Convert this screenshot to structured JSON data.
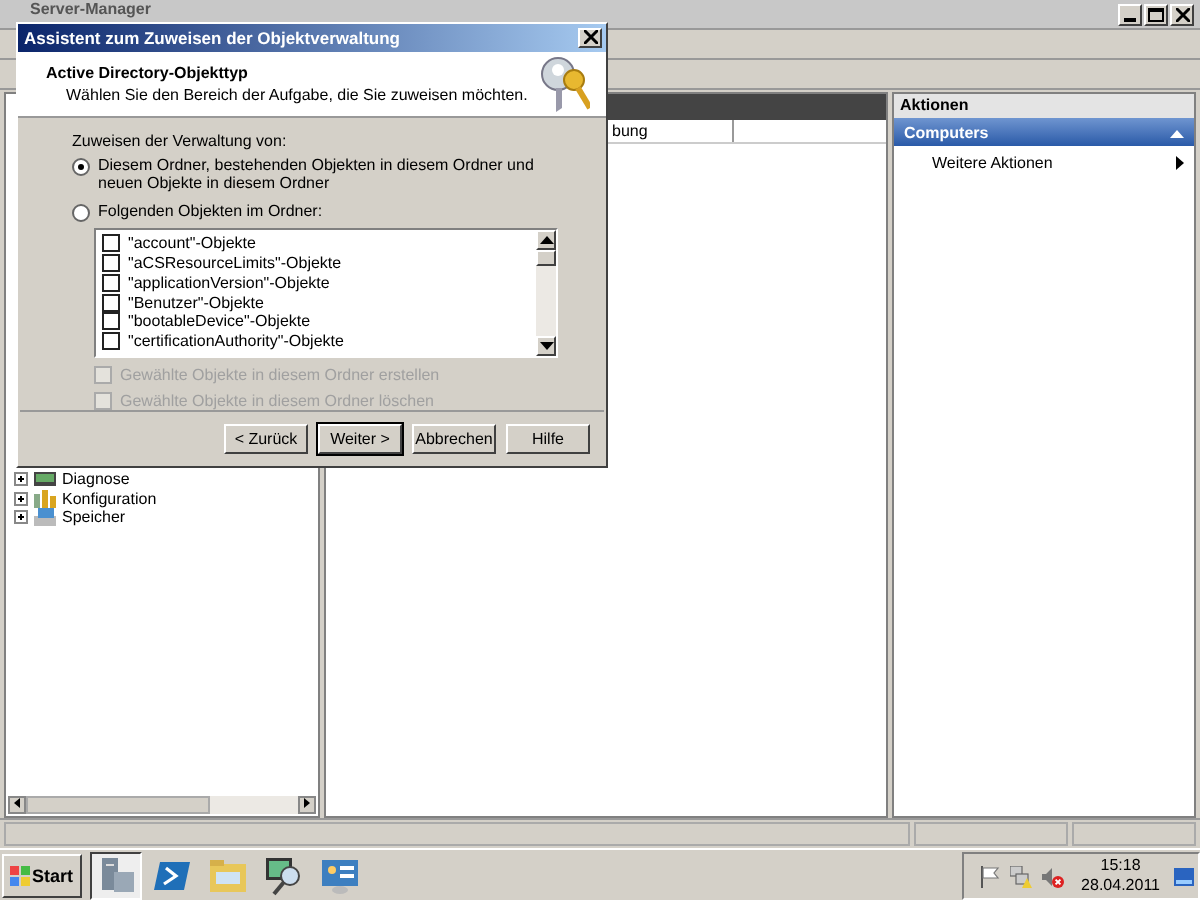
{
  "background_window": {
    "title": "Server-Manager"
  },
  "tree": [
    {
      "label": "Diagnose",
      "expanded": false,
      "kind": "diagnose"
    },
    {
      "label": "Konfiguration",
      "expanded": false,
      "kind": "config"
    },
    {
      "label": "Speicher",
      "expanded": false,
      "kind": "storage"
    }
  ],
  "details": {
    "column_1": "bung"
  },
  "actions": {
    "title": "Aktionen",
    "section": "Computers",
    "expanded": true,
    "items": [
      "Weitere Aktionen"
    ]
  },
  "dialog": {
    "title": "Assistent zum Zuweisen der Objektverwaltung",
    "header_title": "Active Directory-Objekttyp",
    "header_subtitle": "Wählen Sie den Bereich der Aufgabe, die Sie zuweisen möchten.",
    "group_label": "Zuweisen der Verwaltung von:",
    "radios": [
      {
        "label": "Diesem Ordner, bestehenden Objekten in diesem Ordner und neuen Objekte in diesem Ordner",
        "selected": true
      },
      {
        "label": "Folgenden Objekten im Ordner:",
        "selected": false
      }
    ],
    "objects": [
      {
        "label": "\"account\"-Objekte",
        "checked": false
      },
      {
        "label": "\"aCSResourceLimits\"-Objekte",
        "checked": false
      },
      {
        "label": "\"applicationVersion\"-Objekte",
        "checked": false
      },
      {
        "label": "\"Benutzer\"-Objekte",
        "checked": false
      },
      {
        "label": "\"bootableDevice\"-Objekte",
        "checked": false
      },
      {
        "label": "\"certificationAuthority\"-Objekte",
        "checked": false
      }
    ],
    "options": [
      {
        "label": "Gewählte Objekte in diesem Ordner erstellen",
        "checked": false,
        "disabled": true
      },
      {
        "label": "Gewählte Objekte in diesem Ordner löschen",
        "checked": false,
        "disabled": true
      }
    ],
    "buttons": [
      {
        "label": "< Zurück",
        "default": false
      },
      {
        "label": "Weiter >",
        "default": true
      },
      {
        "label": "Abbrechen",
        "default": false
      },
      {
        "label": "Hilfe",
        "default": false
      }
    ]
  },
  "taskbar": {
    "start": "Start",
    "apps": [
      {
        "kind": "server",
        "selected": true
      },
      {
        "kind": "shell",
        "selected": false
      },
      {
        "kind": "folder",
        "selected": false
      },
      {
        "kind": "monitor",
        "selected": false
      },
      {
        "kind": "panel",
        "selected": false
      }
    ],
    "time": "15:18",
    "date": "28.04.2011"
  }
}
